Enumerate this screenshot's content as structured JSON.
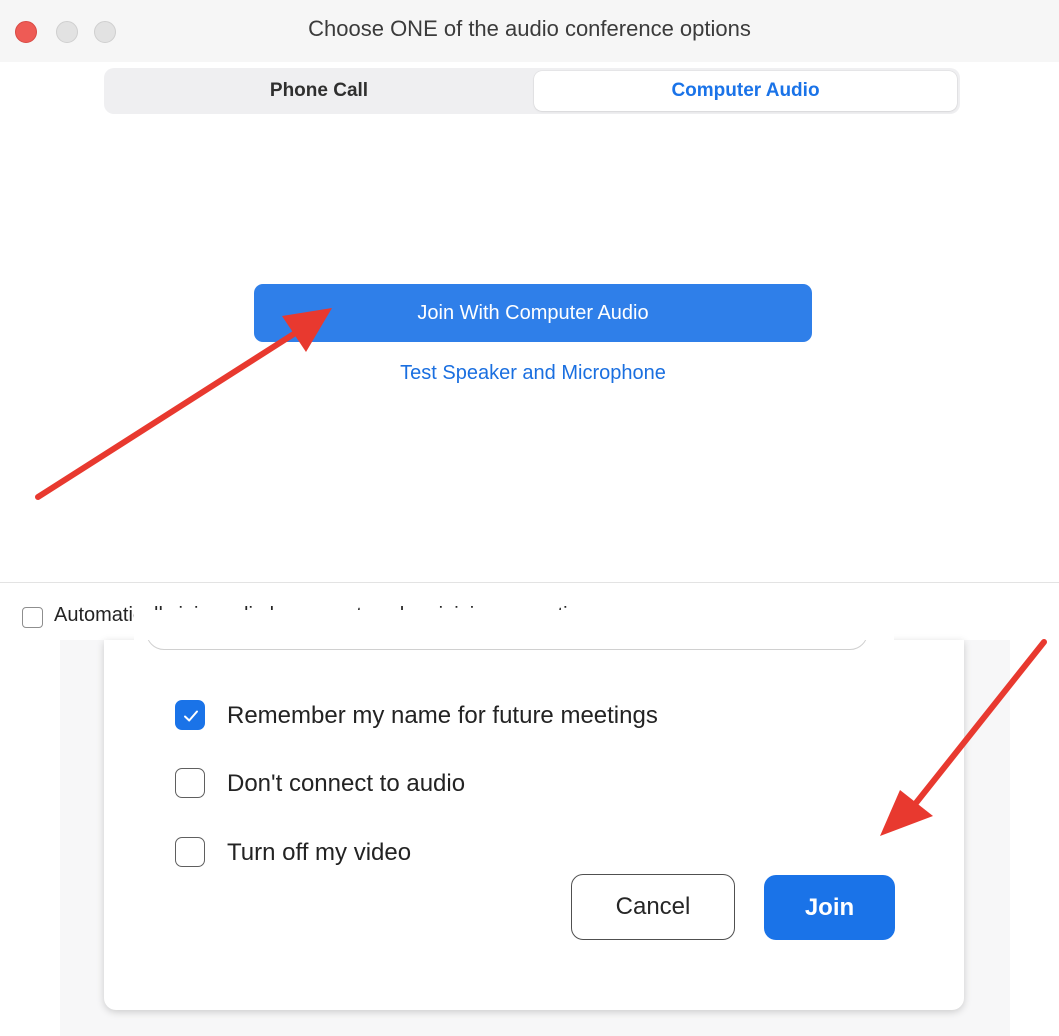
{
  "window": {
    "title": "Choose ONE of the audio conference options"
  },
  "tabs": [
    {
      "label": "Phone Call",
      "selected": false
    },
    {
      "label": "Computer Audio",
      "selected": true
    }
  ],
  "main": {
    "join_button_label": "Join With Computer Audio",
    "test_link_label": "Test Speaker and Microphone"
  },
  "auto_join": {
    "label": "Automatically join audio by computer when joining a meeting",
    "checked": false
  },
  "join_dialog": {
    "options": [
      {
        "label": "Remember my name for future meetings",
        "checked": true
      },
      {
        "label": "Don't connect to audio",
        "checked": false
      },
      {
        "label": "Turn off my video",
        "checked": false
      }
    ],
    "cancel_label": "Cancel",
    "join_label": "Join"
  },
  "colors": {
    "accent": "#1a73e8",
    "primary_button": "#2f7fe9",
    "annotation_arrow": "#e8392f",
    "close_light": "#ee5b55"
  }
}
